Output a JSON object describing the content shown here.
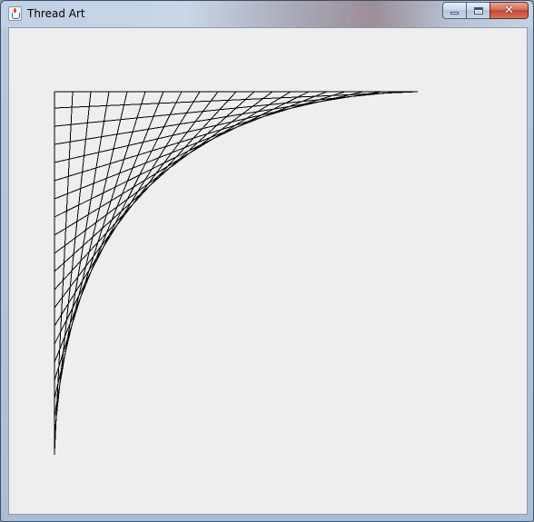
{
  "window": {
    "title": "Thread Art",
    "icon": "java-cup-icon",
    "controls": {
      "minimize": "minimize-icon",
      "maximize": "maximize-icon",
      "close": "close-icon"
    }
  },
  "canvas": {
    "background": "#eeeeee",
    "line_color": "#000000",
    "thread_count": 20
  }
}
